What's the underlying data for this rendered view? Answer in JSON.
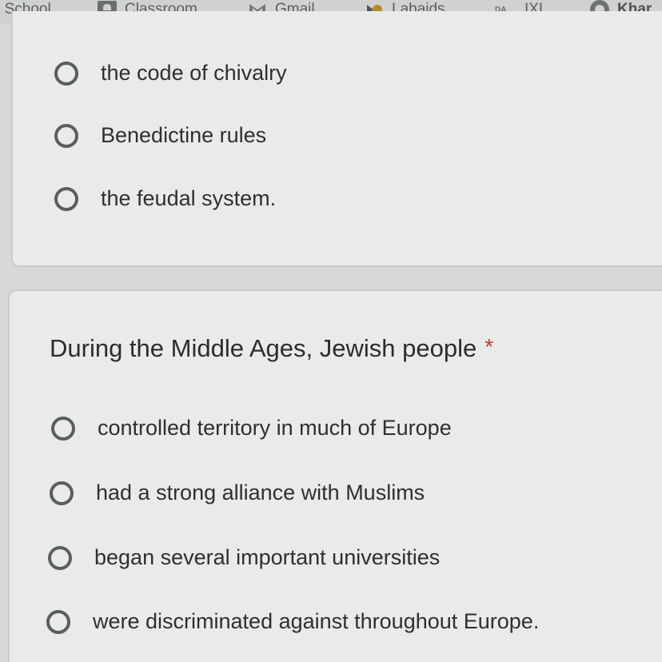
{
  "bookmarks": {
    "items": [
      {
        "label": "r School",
        "icon": "none"
      },
      {
        "label": "Classroom",
        "icon": "classroom-icon"
      },
      {
        "label": "Gmail",
        "icon": "gmail-icon"
      },
      {
        "label": "Labaids",
        "icon": "labaids-icon"
      },
      {
        "label": "IXL",
        "icon": "ixl-icon"
      },
      {
        "label": "Khar",
        "icon": "khan-academy-icon"
      }
    ]
  },
  "previous_question": {
    "options": [
      {
        "label": "the code of chivalry"
      },
      {
        "label": "Benedictine rules"
      },
      {
        "label": "the feudal system."
      }
    ]
  },
  "question": {
    "text": "During the Middle Ages, Jewish people",
    "required_marker": "*",
    "options": [
      {
        "label": "controlled territory in much of Europe"
      },
      {
        "label": "had a strong alliance with Muslims"
      },
      {
        "label": "began several important universities"
      },
      {
        "label": "were discriminated against throughout Europe."
      }
    ]
  },
  "colors": {
    "page_background": "#d7d9d6",
    "card_background": "#e9ebe8",
    "required_marker": "#c0392b",
    "text": "#2d2f31"
  }
}
